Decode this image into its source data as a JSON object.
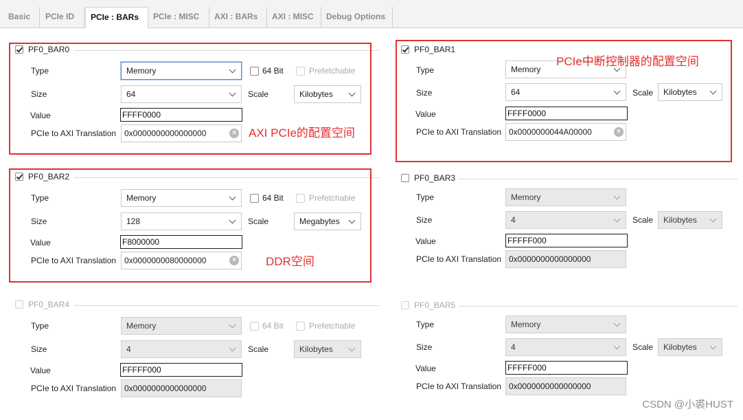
{
  "tabs": [
    {
      "label": "Basic"
    },
    {
      "label": "PCIe ID"
    },
    {
      "label": "PCIe : BARs"
    },
    {
      "label": "PCIe : MISC"
    },
    {
      "label": "AXI : BARs"
    },
    {
      "label": "AXI : MISC"
    },
    {
      "label": "Debug Options"
    }
  ],
  "labels": {
    "type": "Type",
    "size": "Size",
    "scale": "Scale",
    "value": "Value",
    "translation": "PCIe to AXI Translation",
    "bit64": "64 Bit",
    "prefetchable": "Prefetchable"
  },
  "bars": [
    {
      "name": "PF0_BAR0",
      "enabled": true,
      "type": "Memory",
      "size": "64",
      "scale": "Kilobytes",
      "value": "FFFF0000",
      "translation": "0x0000000000000000"
    },
    {
      "name": "PF0_BAR1",
      "enabled": true,
      "type": "Memory",
      "size": "64",
      "scale": "Kilobytes",
      "value": "FFFF0000",
      "translation": "0x0000000044A00000"
    },
    {
      "name": "PF0_BAR2",
      "enabled": true,
      "type": "Memory",
      "size": "128",
      "scale": "Megabytes",
      "value": "F8000000",
      "translation": "0x0000000080000000"
    },
    {
      "name": "PF0_BAR3",
      "enabled": false,
      "type": "Memory",
      "size": "4",
      "scale": "Kilobytes",
      "value": "FFFFF000",
      "translation": "0x0000000000000000"
    },
    {
      "name": "PF0_BAR4",
      "enabled": false,
      "type": "Memory",
      "size": "4",
      "scale": "Kilobytes",
      "value": "FFFFF000",
      "translation": "0x0000000000000000"
    },
    {
      "name": "PF0_BAR5",
      "enabled": false,
      "type": "Memory",
      "size": "4",
      "scale": "Kilobytes",
      "value": "FFFFF000",
      "translation": "0x0000000000000000"
    }
  ],
  "annotations": {
    "bar0": "AXI PCIe的配置空间",
    "bar1": "PCIe中断控制器的配置空间",
    "bar2": "DDR空间"
  },
  "watermark": "CSDN @小裘HUST",
  "colors": {
    "annotation": "#e03030",
    "focus": "#5b8ed6"
  }
}
